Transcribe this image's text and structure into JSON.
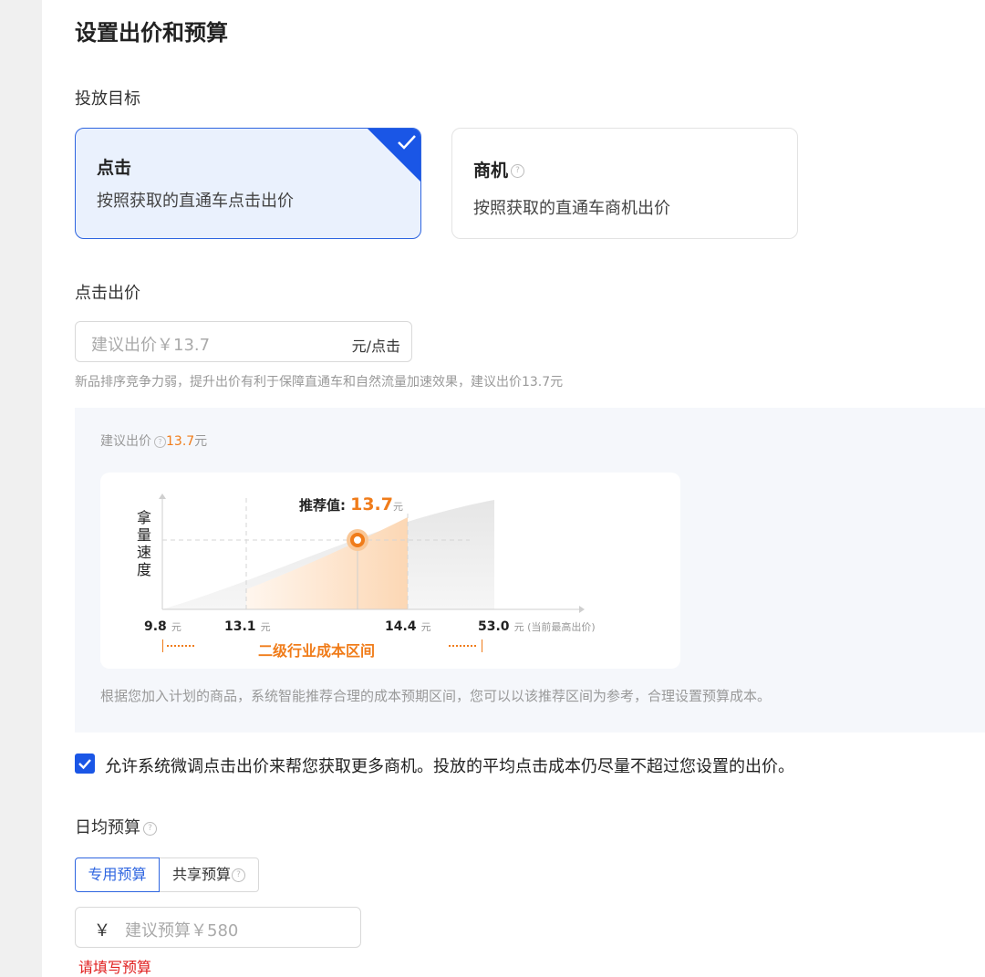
{
  "page": {
    "title": "设置出价和预算"
  },
  "goal": {
    "label": "投放目标",
    "cards": [
      {
        "title": "点击",
        "desc": "按照获取的直通车点击出价",
        "selected": true
      },
      {
        "title": "商机",
        "desc": "按照获取的直通车商机出价",
        "selected": false
      }
    ]
  },
  "bid": {
    "label": "点击出价",
    "placeholder": "建议出价￥13.7",
    "unit": "元/点击",
    "hint": "新品排序竞争力弱，提升出价有利于保障直通车和自然流量加速效果，建议出价13.7元"
  },
  "suggest": {
    "prefix": "建议出价",
    "value": "13.7",
    "unit": "元",
    "footer": "根据您加入计划的商品，系统智能推荐合理的成本预期区间，您可以以该推荐区间为参考，合理设置预算成本。"
  },
  "chart_data": {
    "type": "area",
    "ylabel": "拿量速度",
    "recommend_label": "推荐值:",
    "recommend_value": "13.7",
    "recommend_unit": "元",
    "ticks": [
      {
        "value": "9.8",
        "unit": "元"
      },
      {
        "value": "13.1",
        "unit": "元"
      },
      {
        "value": "14.4",
        "unit": "元"
      },
      {
        "value": "53.0",
        "unit": "元 (当前最高出价)"
      }
    ],
    "range_label": "二级行业成本区间",
    "colors": {
      "accent": "#f07c1a",
      "fill": "#fde3c9",
      "grey": "#ececec"
    }
  },
  "allow": {
    "checked": true,
    "text": "允许系统微调点击出价来帮您获取更多商机。投放的平均点击成本仍尽量不超过您设置的出价。"
  },
  "budget": {
    "label": "日均预算",
    "tabs": [
      {
        "label": "专用预算",
        "active": true
      },
      {
        "label": "共享预算",
        "active": false
      }
    ],
    "currency": "￥",
    "placeholder": "建议预算￥580",
    "error": "请填写预算"
  },
  "icons": {
    "help": "?"
  }
}
